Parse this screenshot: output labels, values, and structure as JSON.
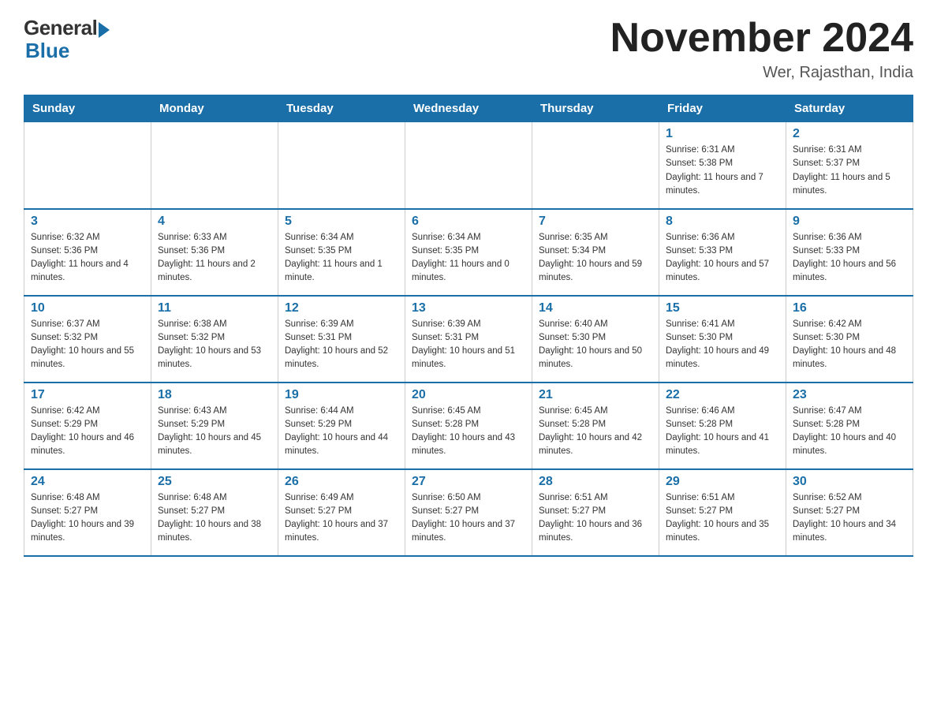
{
  "logo": {
    "general": "General",
    "blue": "Blue"
  },
  "header": {
    "month_year": "November 2024",
    "location": "Wer, Rajasthan, India"
  },
  "weekdays": [
    "Sunday",
    "Monday",
    "Tuesday",
    "Wednesday",
    "Thursday",
    "Friday",
    "Saturday"
  ],
  "weeks": [
    [
      {
        "day": "",
        "info": ""
      },
      {
        "day": "",
        "info": ""
      },
      {
        "day": "",
        "info": ""
      },
      {
        "day": "",
        "info": ""
      },
      {
        "day": "",
        "info": ""
      },
      {
        "day": "1",
        "info": "Sunrise: 6:31 AM\nSunset: 5:38 PM\nDaylight: 11 hours and 7 minutes."
      },
      {
        "day": "2",
        "info": "Sunrise: 6:31 AM\nSunset: 5:37 PM\nDaylight: 11 hours and 5 minutes."
      }
    ],
    [
      {
        "day": "3",
        "info": "Sunrise: 6:32 AM\nSunset: 5:36 PM\nDaylight: 11 hours and 4 minutes."
      },
      {
        "day": "4",
        "info": "Sunrise: 6:33 AM\nSunset: 5:36 PM\nDaylight: 11 hours and 2 minutes."
      },
      {
        "day": "5",
        "info": "Sunrise: 6:34 AM\nSunset: 5:35 PM\nDaylight: 11 hours and 1 minute."
      },
      {
        "day": "6",
        "info": "Sunrise: 6:34 AM\nSunset: 5:35 PM\nDaylight: 11 hours and 0 minutes."
      },
      {
        "day": "7",
        "info": "Sunrise: 6:35 AM\nSunset: 5:34 PM\nDaylight: 10 hours and 59 minutes."
      },
      {
        "day": "8",
        "info": "Sunrise: 6:36 AM\nSunset: 5:33 PM\nDaylight: 10 hours and 57 minutes."
      },
      {
        "day": "9",
        "info": "Sunrise: 6:36 AM\nSunset: 5:33 PM\nDaylight: 10 hours and 56 minutes."
      }
    ],
    [
      {
        "day": "10",
        "info": "Sunrise: 6:37 AM\nSunset: 5:32 PM\nDaylight: 10 hours and 55 minutes."
      },
      {
        "day": "11",
        "info": "Sunrise: 6:38 AM\nSunset: 5:32 PM\nDaylight: 10 hours and 53 minutes."
      },
      {
        "day": "12",
        "info": "Sunrise: 6:39 AM\nSunset: 5:31 PM\nDaylight: 10 hours and 52 minutes."
      },
      {
        "day": "13",
        "info": "Sunrise: 6:39 AM\nSunset: 5:31 PM\nDaylight: 10 hours and 51 minutes."
      },
      {
        "day": "14",
        "info": "Sunrise: 6:40 AM\nSunset: 5:30 PM\nDaylight: 10 hours and 50 minutes."
      },
      {
        "day": "15",
        "info": "Sunrise: 6:41 AM\nSunset: 5:30 PM\nDaylight: 10 hours and 49 minutes."
      },
      {
        "day": "16",
        "info": "Sunrise: 6:42 AM\nSunset: 5:30 PM\nDaylight: 10 hours and 48 minutes."
      }
    ],
    [
      {
        "day": "17",
        "info": "Sunrise: 6:42 AM\nSunset: 5:29 PM\nDaylight: 10 hours and 46 minutes."
      },
      {
        "day": "18",
        "info": "Sunrise: 6:43 AM\nSunset: 5:29 PM\nDaylight: 10 hours and 45 minutes."
      },
      {
        "day": "19",
        "info": "Sunrise: 6:44 AM\nSunset: 5:29 PM\nDaylight: 10 hours and 44 minutes."
      },
      {
        "day": "20",
        "info": "Sunrise: 6:45 AM\nSunset: 5:28 PM\nDaylight: 10 hours and 43 minutes."
      },
      {
        "day": "21",
        "info": "Sunrise: 6:45 AM\nSunset: 5:28 PM\nDaylight: 10 hours and 42 minutes."
      },
      {
        "day": "22",
        "info": "Sunrise: 6:46 AM\nSunset: 5:28 PM\nDaylight: 10 hours and 41 minutes."
      },
      {
        "day": "23",
        "info": "Sunrise: 6:47 AM\nSunset: 5:28 PM\nDaylight: 10 hours and 40 minutes."
      }
    ],
    [
      {
        "day": "24",
        "info": "Sunrise: 6:48 AM\nSunset: 5:27 PM\nDaylight: 10 hours and 39 minutes."
      },
      {
        "day": "25",
        "info": "Sunrise: 6:48 AM\nSunset: 5:27 PM\nDaylight: 10 hours and 38 minutes."
      },
      {
        "day": "26",
        "info": "Sunrise: 6:49 AM\nSunset: 5:27 PM\nDaylight: 10 hours and 37 minutes."
      },
      {
        "day": "27",
        "info": "Sunrise: 6:50 AM\nSunset: 5:27 PM\nDaylight: 10 hours and 37 minutes."
      },
      {
        "day": "28",
        "info": "Sunrise: 6:51 AM\nSunset: 5:27 PM\nDaylight: 10 hours and 36 minutes."
      },
      {
        "day": "29",
        "info": "Sunrise: 6:51 AM\nSunset: 5:27 PM\nDaylight: 10 hours and 35 minutes."
      },
      {
        "day": "30",
        "info": "Sunrise: 6:52 AM\nSunset: 5:27 PM\nDaylight: 10 hours and 34 minutes."
      }
    ]
  ]
}
